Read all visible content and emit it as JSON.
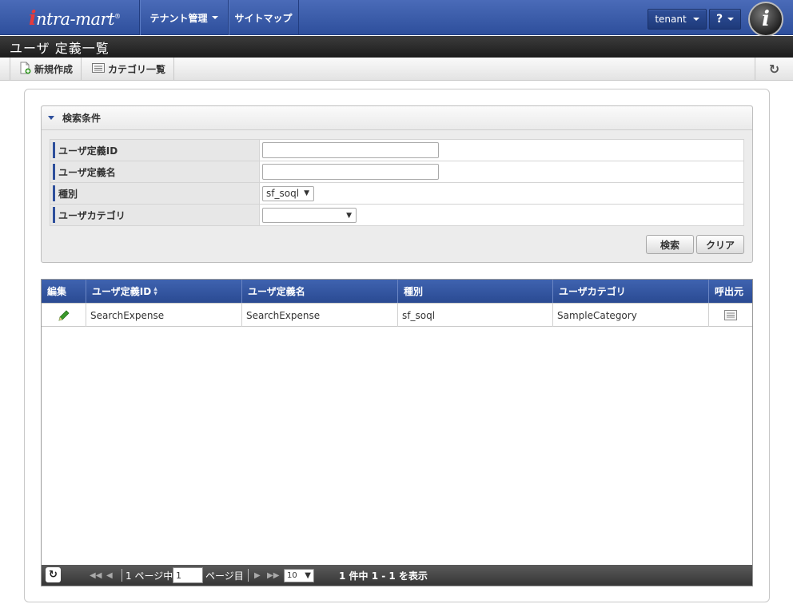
{
  "header": {
    "logo_main": "ntra-mart",
    "logo_i": "i",
    "logo_reg": "®",
    "nav": [
      {
        "label": "テナント管理",
        "has_caret": true
      },
      {
        "label": "サイトマップ",
        "has_caret": false
      }
    ],
    "tenant_label": "tenant",
    "help_label": "?",
    "info_icon_glyph": "i"
  },
  "title": "ユーザ 定義一覧",
  "toolbar": {
    "new_label": "新規作成",
    "category_label": "カテゴリ一覧",
    "refresh_glyph": "↻"
  },
  "search": {
    "heading": "検索条件",
    "fields": [
      {
        "label": "ユーザ定義ID",
        "type": "text",
        "value": ""
      },
      {
        "label": "ユーザ定義名",
        "type": "text",
        "value": ""
      },
      {
        "label": "種別",
        "type": "select",
        "value": "sf_soql"
      },
      {
        "label": "ユーザカテゴリ",
        "type": "select",
        "value": ""
      }
    ],
    "search_button": "検索",
    "clear_button": "クリア"
  },
  "grid": {
    "columns": [
      "編集",
      "ユーザ定義ID",
      "ユーザ定義名",
      "種別",
      "ユーザカテゴリ",
      "呼出元"
    ],
    "rows": [
      {
        "id": "SearchExpense",
        "name": "SearchExpense",
        "type": "sf_soql",
        "category": "SampleCategory"
      }
    ],
    "pager": {
      "page_prefix": "1 ページ中",
      "page_value": "1",
      "page_suffix": "ページ目",
      "rows_per_page": "10",
      "summary": "1 件中 1 - 1 を表示"
    }
  },
  "colors": {
    "header_blue": "#2e4f9c",
    "title_bar": "#2a2a2a",
    "grid_header": "#3454a2",
    "edit_icon_green": "#3a9a2a"
  }
}
